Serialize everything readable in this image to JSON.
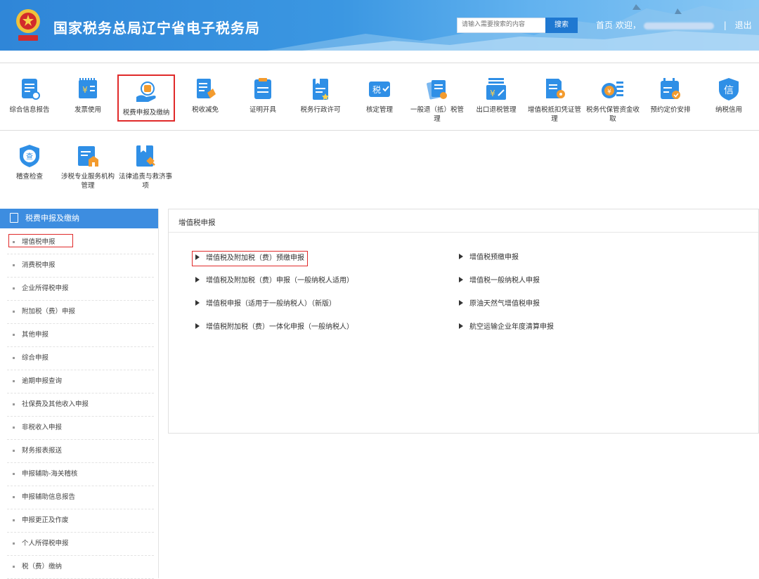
{
  "header": {
    "title": "国家税务总局辽宁省电子税务局",
    "search_placeholder": "请输入需要搜索的内容",
    "search_button": "搜索",
    "home": "首页",
    "welcome": "欢迎，",
    "logout": "退出",
    "separator": "|"
  },
  "toolbar": {
    "items": [
      {
        "label": "综合信息报告",
        "icon": "report-icon"
      },
      {
        "label": "发票使用",
        "icon": "invoice-icon"
      },
      {
        "label": "税费申报及缴纳",
        "icon": "tax-declare-icon"
      },
      {
        "label": "税收减免",
        "icon": "tax-relief-icon"
      },
      {
        "label": "证明开具",
        "icon": "certificate-icon"
      },
      {
        "label": "税务行政许可",
        "icon": "license-icon"
      },
      {
        "label": "核定管理",
        "icon": "assessment-icon"
      },
      {
        "label": "一般退（抵）税管理",
        "icon": "refund-icon"
      },
      {
        "label": "出口退税管理",
        "icon": "export-refund-icon"
      },
      {
        "label": "增值税抵扣凭证管理",
        "icon": "vat-deduction-icon"
      },
      {
        "label": "税务代保管资金收取",
        "icon": "custody-fund-icon"
      },
      {
        "label": "预约定价安排",
        "icon": "pricing-icon"
      },
      {
        "label": "纳税信用",
        "icon": "credit-icon"
      },
      {
        "label": "稽查检查",
        "icon": "inspection-icon"
      },
      {
        "label": "涉税专业服务机构管理",
        "icon": "agency-icon"
      },
      {
        "label": "法律追责与救济事项",
        "icon": "legal-icon"
      }
    ]
  },
  "sidebar": {
    "title": "税费申报及缴纳",
    "items": [
      "增值税申报",
      "消费税申报",
      "企业所得税申报",
      "附加税（费）申报",
      "其他申报",
      "综合申报",
      "逾期申报查询",
      "社保费及其他收入申报",
      "非税收入申报",
      "财务报表报送",
      "申报辅助-海关稽核",
      "申报辅助信息报告",
      "申报更正及作废",
      "个人所得税申报",
      "税（费）缴纳"
    ]
  },
  "main": {
    "title": "增值税申报",
    "left_links": [
      "增值税及附加税（费）预缴申报",
      "增值税及附加税（费）申报（一般纳税人适用）",
      "增值税申报（适用于一般纳税人）（新版）",
      "增值税附加税（费）一体化申报（一般纳税人）"
    ],
    "right_links": [
      "增值税预缴申报",
      "增值税一般纳税人申报",
      "原油天然气增值税申报",
      "航空运输企业年度清算申报"
    ]
  },
  "colors": {
    "primary": "#3d8de0",
    "highlight": "#e02a2a",
    "icon_blue": "#2f8fe6"
  }
}
